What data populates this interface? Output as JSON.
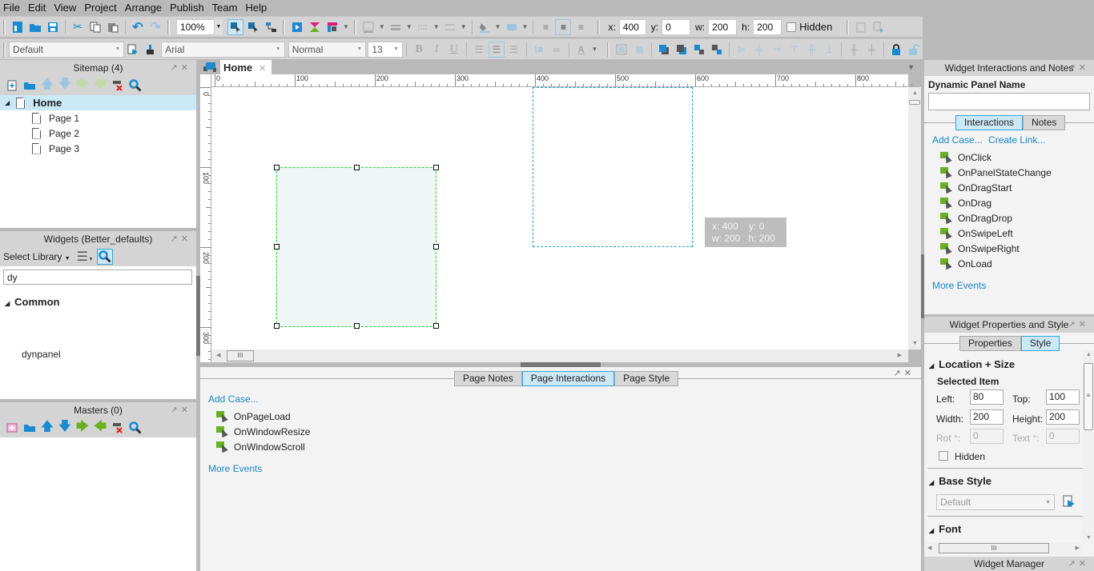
{
  "menu": [
    "File",
    "Edit",
    "View",
    "Project",
    "Arrange",
    "Publish",
    "Team",
    "Help"
  ],
  "toolbar": {
    "zoom": "100%",
    "coords": {
      "x_label": "x:",
      "x": "400",
      "y_label": "y:",
      "y": "0",
      "w_label": "w:",
      "w": "200",
      "h_label": "h:",
      "h": "200"
    },
    "hidden_label": "Hidden",
    "style_select": "Default",
    "font_select": "Arial",
    "weight_select": "Normal",
    "size_select": "13",
    "bold": "B",
    "italic": "I",
    "underline": "U",
    "font_color": "A"
  },
  "sitemap": {
    "title": "Sitemap (4)",
    "pages": [
      {
        "label": "Home",
        "selected": true
      },
      {
        "label": "Page 1"
      },
      {
        "label": "Page 2"
      },
      {
        "label": "Page 3"
      }
    ]
  },
  "widgets": {
    "title": "Widgets (Better_defaults)",
    "select_library": "Select Library",
    "search_value": "dy",
    "group": "Common",
    "items": [
      "dynpanel"
    ]
  },
  "masters": {
    "title": "Masters (0)"
  },
  "canvas": {
    "tab": "Home",
    "ruler_top": [
      "0",
      "100",
      "200",
      "300",
      "400",
      "500",
      "600",
      "700",
      "800"
    ],
    "ruler_left": [
      "0",
      "100",
      "200",
      "300"
    ],
    "tooltip": {
      "x": "x: 400",
      "y": "y: 0",
      "w": "w: 200",
      "h": "h: 200"
    }
  },
  "page_panel": {
    "tabs": [
      "Page Notes",
      "Page Interactions",
      "Page Style"
    ],
    "active_tab": "Page Interactions",
    "add_case": "Add Case...",
    "events": [
      "OnPageLoad",
      "OnWindowResize",
      "OnWindowScroll"
    ],
    "more_events": "More Events"
  },
  "interactions_panel": {
    "title": "Widget Interactions and Notes",
    "name_label": "Dynamic Panel Name",
    "name_value": "",
    "tabs": [
      "Interactions",
      "Notes"
    ],
    "add_case": "Add Case...",
    "create_link": "Create Link...",
    "events": [
      "OnClick",
      "OnPanelStateChange",
      "OnDragStart",
      "OnDrag",
      "OnDragDrop",
      "OnSwipeLeft",
      "OnSwipeRight",
      "OnLoad"
    ],
    "more_events": "More Events"
  },
  "properties_panel": {
    "title": "Widget Properties and Style",
    "tabs": [
      "Properties",
      "Style"
    ],
    "location_section": "Location + Size",
    "selected_item": "Selected Item",
    "left_label": "Left:",
    "left": "80",
    "top_label": "Top:",
    "top": "100",
    "width_label": "Width:",
    "width": "200",
    "height_label": "Height:",
    "height": "200",
    "rot_label": "Rot °:",
    "rot": "0",
    "text_label": "Text °:",
    "text": "0",
    "hidden_label": "Hidden",
    "base_style_section": "Base Style",
    "base_style_value": "Default",
    "font_section": "Font"
  },
  "widget_manager": {
    "title": "Widget Manager"
  }
}
